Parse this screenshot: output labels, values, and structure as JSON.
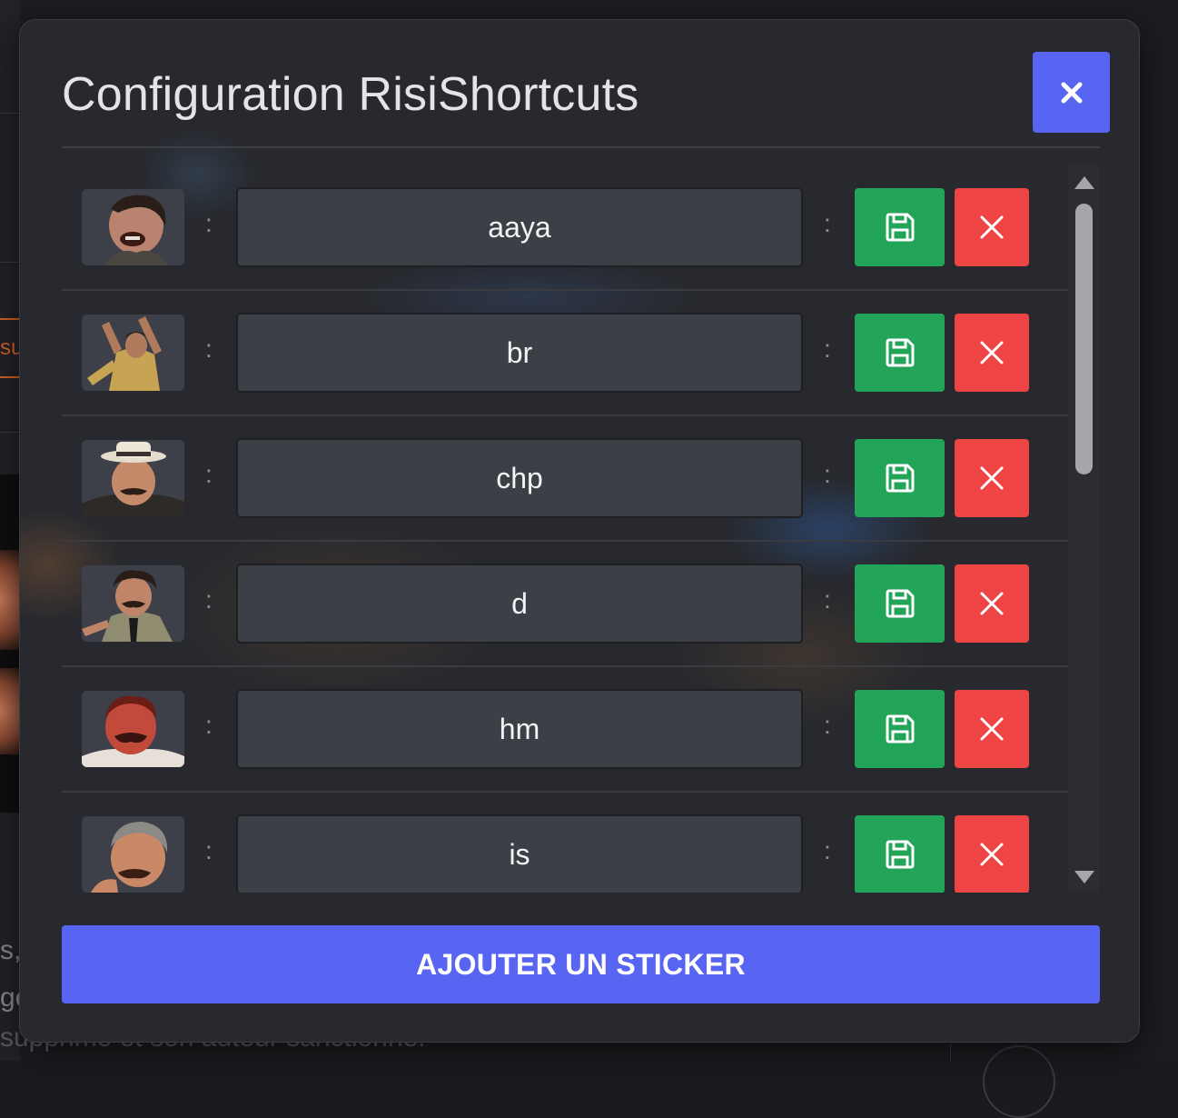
{
  "modal": {
    "title": "Configuration RisiShortcuts",
    "close_icon": "close-icon",
    "add_button_label": "AJOUTER UN STICKER"
  },
  "separator": ":",
  "stickers": [
    {
      "name": "aaya",
      "thumb": "laughing-man-sticker"
    },
    {
      "name": "br",
      "thumb": "clapping-man-sticker"
    },
    {
      "name": "chp",
      "thumb": "man-with-hat-sticker"
    },
    {
      "name": "d",
      "thumb": "man-pointing-sticker"
    },
    {
      "name": "hm",
      "thumb": "red-face-man-sticker"
    },
    {
      "name": "is",
      "thumb": "grey-hair-man-sticker"
    }
  ],
  "icons": {
    "save": "save-icon",
    "delete": "delete-icon"
  },
  "colors": {
    "accent": "#5865f2",
    "save": "#23a559",
    "delete": "#ee4444",
    "modal_bg": "#27292e"
  },
  "background": {
    "partial_text_1": "su",
    "partial_text_2": "s,",
    "partial_text_3": "ge",
    "partial_text_4": "supprimé et son auteur sanctionné."
  }
}
